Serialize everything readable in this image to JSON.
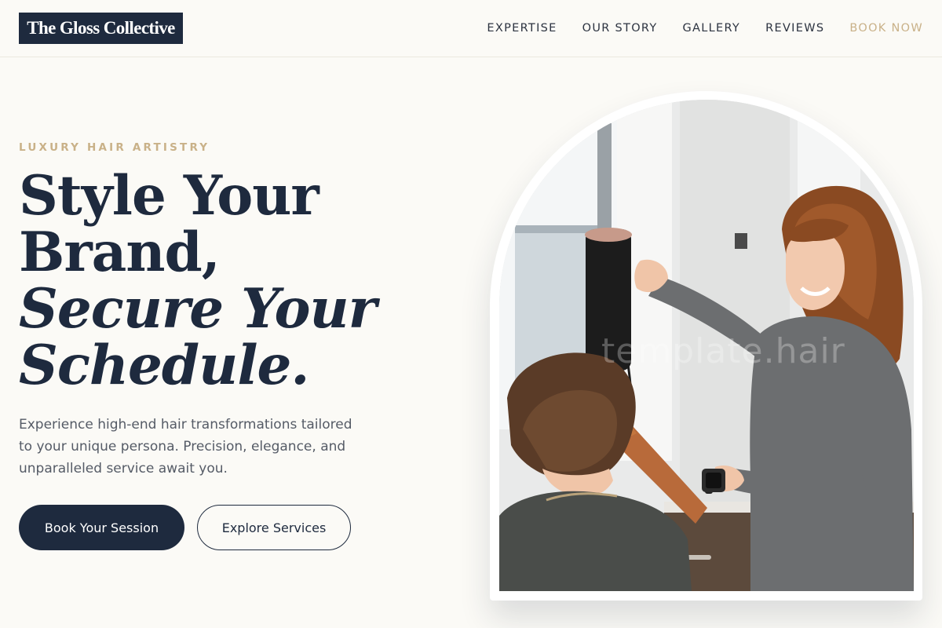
{
  "header": {
    "logo": "The Gloss Collective",
    "nav": [
      {
        "label": "EXPERTISE"
      },
      {
        "label": "OUR STORY"
      },
      {
        "label": "GALLERY"
      },
      {
        "label": "REVIEWS"
      },
      {
        "label": "BOOK NOW"
      }
    ]
  },
  "hero": {
    "eyebrow": "LUXURY HAIR ARTISTRY",
    "headline": {
      "line1": "Style Your",
      "line2": "Brand,",
      "line3": "Secure Your",
      "line4": "Schedule."
    },
    "lead": "Experience high-end hair transformations tailored to your unique persona. Precision, elegance, and unparalleled service await you.",
    "primary_button": "Book Your Session",
    "secondary_button": "Explore Services",
    "image_watermark": "template.hair"
  },
  "colors": {
    "background": "#fbfaf6",
    "navy": "#1e2a3e",
    "gold_accent": "#c9b188",
    "body_text": "#555b66"
  }
}
